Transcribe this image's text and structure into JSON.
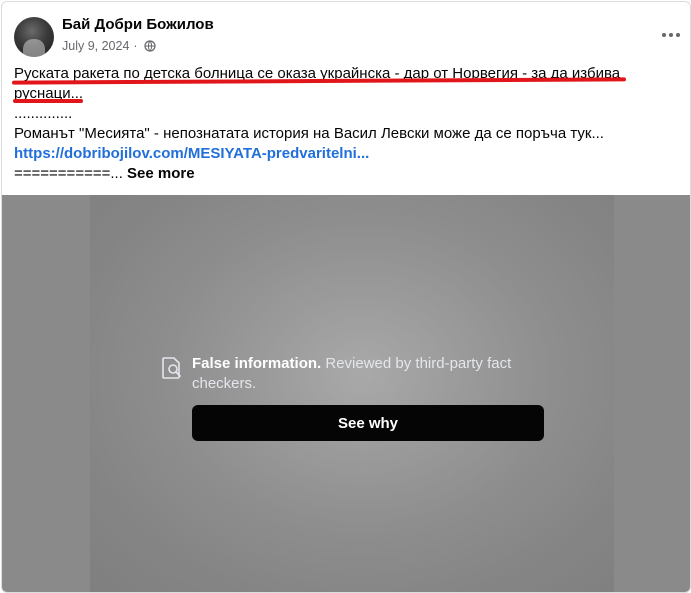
{
  "post": {
    "author": "Бай Добри Божилов",
    "date": "July 9, 2024",
    "separator": "·",
    "privacy_icon": "globe-icon",
    "menu_icon": "more-options-icon",
    "lines": {
      "line1": "Руската ракета по детска болница се оказа украйнска - дар от Норвегия - за да избива",
      "line2": "руснаци...",
      "line3": "..............",
      "line4": "Романът \"Месията\" - непознатата история на Васил Левски може да се поръча тук...",
      "link": "https://dobribojilov.com/MESIYATA-predvaritelni...",
      "line6_prefix": "===========... ",
      "see_more": "See more"
    }
  },
  "overlay": {
    "icon": "fact-check-icon",
    "title": "False information.",
    "description": " Reviewed by third-party fact checkers.",
    "button_label": "See why"
  },
  "colors": {
    "highlight_underline": "#e1161b",
    "link": "#216fdb",
    "button_bg": "#050505"
  }
}
